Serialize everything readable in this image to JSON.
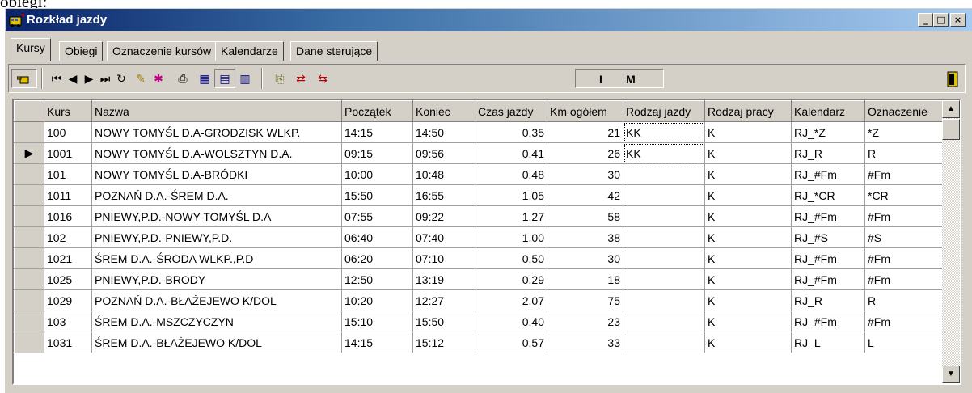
{
  "doc_fragment": "obiegi:",
  "window": {
    "title": "Rozkład jazdy",
    "buttons": [
      "_",
      "□",
      "×"
    ]
  },
  "tabs": [
    "Kursy",
    "Obiegi",
    "Oznaczenie kursów",
    "Kalendarze",
    "Dane sterujące"
  ],
  "active_tab": "Kursy",
  "toolbar": {
    "pointer_icon": "hand-pointer-icon",
    "nav_first": "first-record-icon",
    "nav_prev": "prev-record-icon",
    "nav_next": "next-record-icon",
    "nav_last": "last-record-icon",
    "refresh": "refresh-icon",
    "mode_i_label": "I",
    "mode_m_label": "M",
    "exit_icon": "exit-door-icon"
  },
  "grid": {
    "columns": [
      "Kurs",
      "Nazwa",
      "Początek",
      "Koniec",
      "Czas jazdy",
      "Km ogółem",
      "Rodzaj jazdy",
      "Rodzaj pracy",
      "Kalendarz",
      "Oznaczenie"
    ],
    "current_row_index": 1,
    "rows": [
      [
        "100",
        "NOWY TOMYŚL D.A-GRODZISK WLKP.",
        "14:15",
        "14:50",
        "0.35",
        "21",
        "KK",
        "K",
        "RJ_*Z",
        "*Z"
      ],
      [
        "1001",
        "NOWY TOMYŚL D.A-WOLSZTYN D.A.",
        "09:15",
        "09:56",
        "0.41",
        "26",
        "KK",
        "K",
        "RJ_R",
        "R"
      ],
      [
        "101",
        "NOWY TOMYŚL D.A-BRÓDKI",
        "10:00",
        "10:48",
        "0.48",
        "30",
        "",
        "K",
        "RJ_#Fm",
        "#Fm"
      ],
      [
        "1011",
        "POZNAŃ D.A.-ŚREM D.A.",
        "15:50",
        "16:55",
        "1.05",
        "42",
        "",
        "K",
        "RJ_*CR",
        "*CR"
      ],
      [
        "1016",
        "PNIEWY,P.D.-NOWY TOMYŚL D.A",
        "07:55",
        "09:22",
        "1.27",
        "58",
        "",
        "K",
        "RJ_#Fm",
        "#Fm"
      ],
      [
        "102",
        "PNIEWY,P.D.-PNIEWY,P.D.",
        "06:40",
        "07:40",
        "1.00",
        "38",
        "",
        "K",
        "RJ_#S",
        "#S"
      ],
      [
        "1021",
        "ŚREM D.A.-ŚRODA WLKP.,P.D",
        "06:20",
        "07:10",
        "0.50",
        "30",
        "",
        "K",
        "RJ_#Fm",
        "#Fm"
      ],
      [
        "1025",
        "PNIEWY,P.D.-BRODY",
        "12:50",
        "13:19",
        "0.29",
        "18",
        "",
        "K",
        "RJ_#Fm",
        "#Fm"
      ],
      [
        "1029",
        "POZNAŃ D.A.-BŁAŻEJEWO K/DOL",
        "10:20",
        "12:27",
        "2.07",
        "75",
        "",
        "K",
        "RJ_R",
        "R"
      ],
      [
        "103",
        "ŚREM D.A.-MSZCZYCZYN",
        "15:10",
        "15:50",
        "0.40",
        "23",
        "",
        "K",
        "RJ_#Fm",
        "#Fm"
      ],
      [
        "1031",
        "ŚREM D.A.-BŁAŻEJEWO K/DOL",
        "14:15",
        "15:12",
        "0.57",
        "33",
        "",
        "K",
        "RJ_L",
        "L"
      ]
    ]
  },
  "colors": {
    "titlebar_start": "#0a246a",
    "titlebar_end": "#a6caf0",
    "face": "#d4d0c8"
  }
}
